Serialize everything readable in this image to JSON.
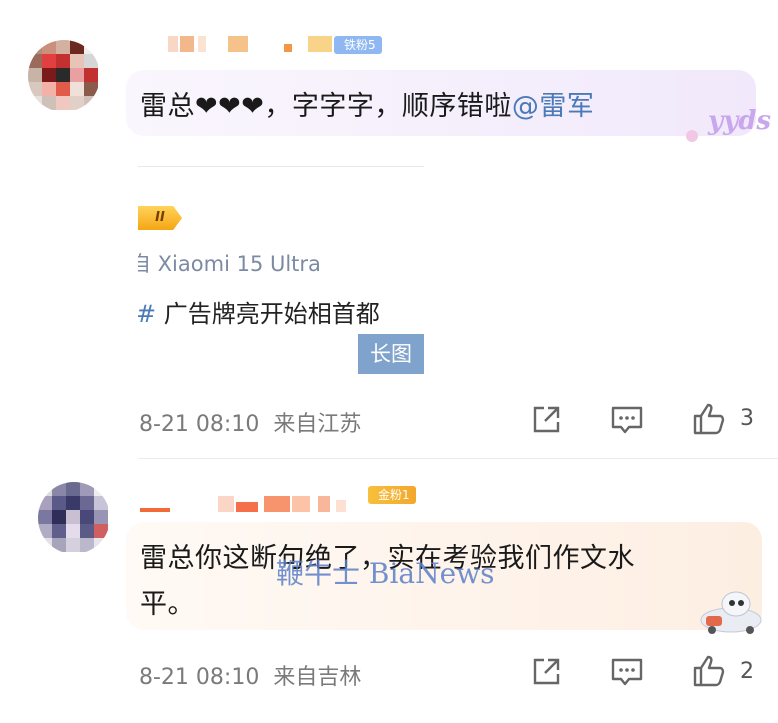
{
  "comments": [
    {
      "fan_badge": "铁粉5",
      "text_before": "雷总❤❤❤，字字字，顺序错啦",
      "mention": "@雷军",
      "sticker": "yyds",
      "quoted_post": {
        "source": "自 Xiaomi 15 Ultra",
        "topic_hash": "#",
        "topic": " 广告牌亮开始相首都",
        "long_image_label": "长图"
      },
      "time": "8-21 08:10",
      "location": "来自江苏",
      "likes": "3"
    },
    {
      "fan_badge": "金粉1",
      "text_line1": "雷总你这断句绝了，实在考验我们作文水",
      "text_line2": "平。",
      "time": "8-21 08:10",
      "location": "来自吉林",
      "likes": "2"
    }
  ],
  "watermark": "鞭牛士 BiaNews",
  "colors": {
    "link": "#4a7ab8",
    "bubble1": "#f6f1fb",
    "bubble2": "#fdf3ea"
  }
}
